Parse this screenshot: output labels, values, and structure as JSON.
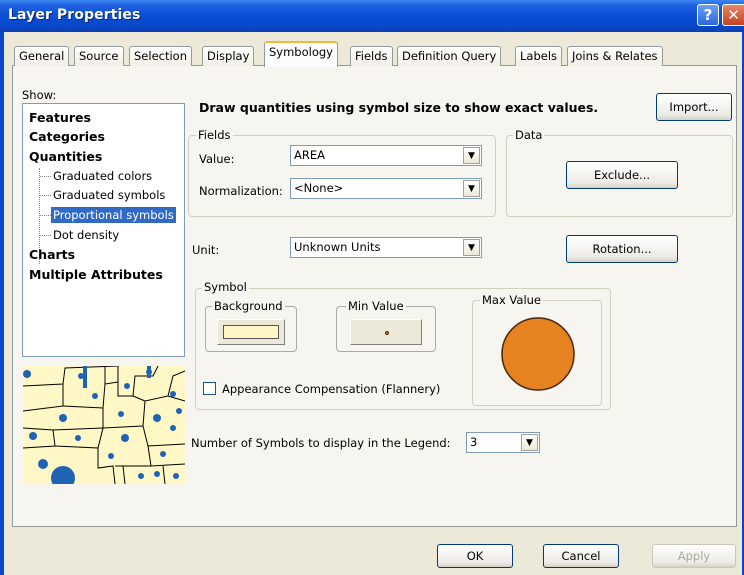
{
  "window": {
    "title": "Layer Properties",
    "help_glyph": "?",
    "close_glyph": "✕"
  },
  "tabs": [
    {
      "label": "General"
    },
    {
      "label": "Source"
    },
    {
      "label": "Selection"
    },
    {
      "label": "Display"
    },
    {
      "label": "Symbology",
      "active": true
    },
    {
      "label": "Fields"
    },
    {
      "label": "Definition Query"
    },
    {
      "label": "Labels"
    },
    {
      "label": "Joins & Relates"
    }
  ],
  "show": {
    "label": "Show:",
    "items": {
      "features": "Features",
      "categories": "Categories",
      "quantities": "Quantities",
      "graduated_colors": "Graduated colors",
      "graduated_symbols": "Graduated symbols",
      "proportional_symbols": "Proportional symbols",
      "dot_density": "Dot density",
      "charts": "Charts",
      "multiple_attributes": "Multiple Attributes"
    },
    "selected": "Proportional symbols"
  },
  "description": "Draw quantities using symbol size to show exact values.",
  "import_label": "Import...",
  "fields": {
    "legend": "Fields",
    "value_label": "Value:",
    "value": "AREA",
    "normalization_label": "Normalization:",
    "normalization": "<None>"
  },
  "data_group": {
    "legend": "Data",
    "exclude_label": "Exclude..."
  },
  "unit": {
    "label": "Unit:",
    "value": "Unknown Units"
  },
  "rotation_label": "Rotation...",
  "symbol": {
    "legend": "Symbol",
    "background_label": "Background",
    "min_value_label": "Min Value",
    "max_value_label": "Max Value",
    "background_color": "#fff7c6",
    "symbol_fill": "#e6821f",
    "symbol_outline": "#4a2a10"
  },
  "appearance_compensation": {
    "label": "Appearance Compensation (Flannery)",
    "checked": false
  },
  "legend_count": {
    "label": "Number of Symbols to display in the Legend:",
    "value": "3"
  },
  "footer": {
    "ok": "OK",
    "cancel": "Cancel",
    "apply": "Apply"
  },
  "colors": {
    "titlebar": "#0a4fd6",
    "selection": "#316ac5",
    "map_fill": "#fff7c6",
    "map_symbol": "#1e63b4"
  }
}
